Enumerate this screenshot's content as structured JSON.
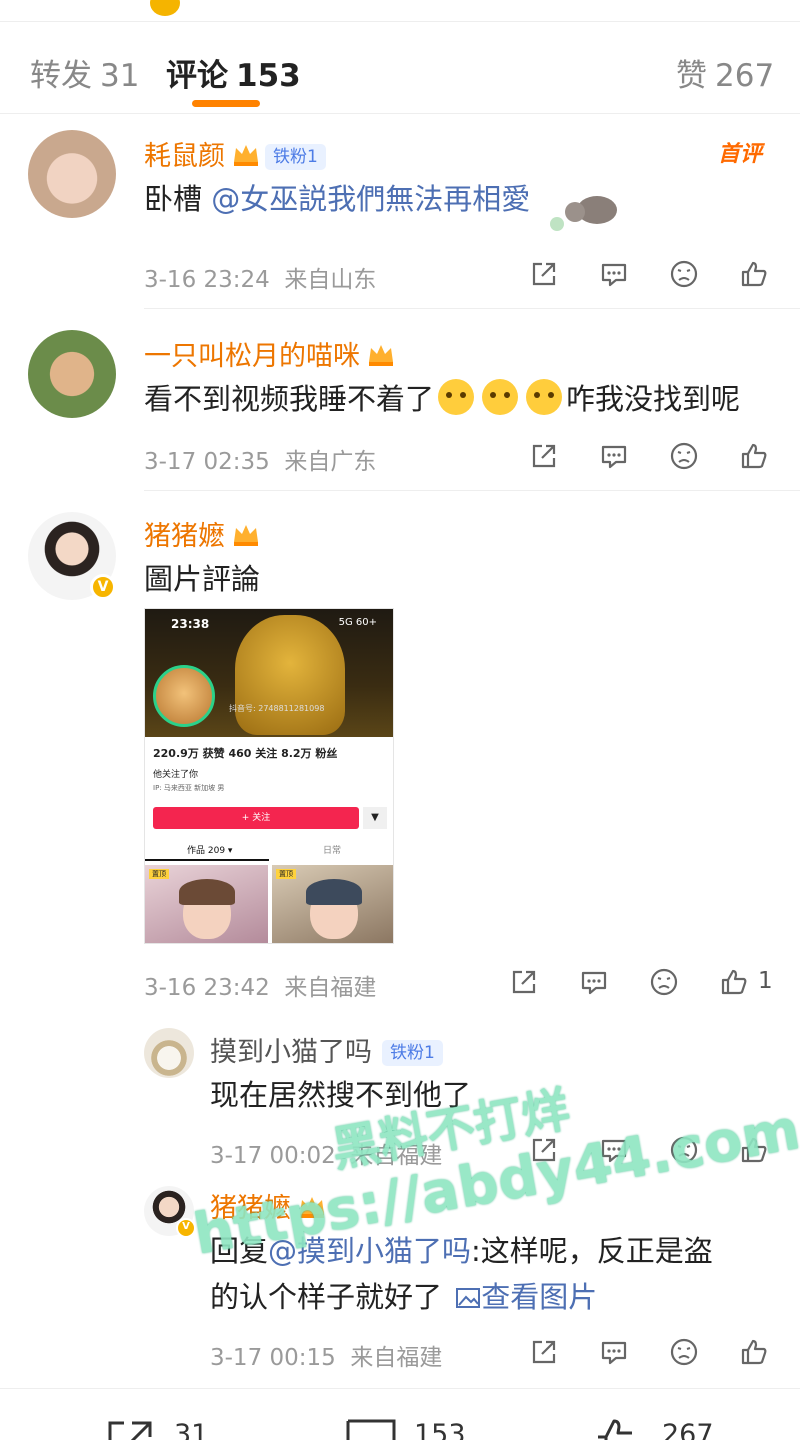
{
  "tabs": {
    "repost": {
      "label": "转发",
      "count": "31"
    },
    "comments": {
      "label": "评论",
      "count": "153"
    },
    "likes": {
      "label": "赞",
      "count": "267"
    }
  },
  "comments": [
    {
      "name": "耗鼠颜",
      "fan_badge": "铁粉1",
      "first_badge": "首评",
      "text_prefix": "卧槽 ",
      "mention": "@女巫説我們無法再相愛",
      "time": "3-16 23:24",
      "location": "来自山东"
    },
    {
      "name": "一只叫松月的喵咪",
      "text_part1": "看不到视频我睡不着了",
      "text_part2": "咋我没找到呢",
      "time": "3-17 02:35",
      "location": "来自广东"
    },
    {
      "name": "猪猪嬷",
      "text": "圖片評論",
      "time": "3-16 23:42",
      "location": "来自福建",
      "like_count": "1",
      "image": {
        "time": "23:38",
        "status": "5G 60+",
        "account_id": "抖音号: 2748811281098",
        "stats": "220.9万 获赞  460 关注  8.2万 粉丝",
        "follow_note": "他关注了你",
        "ip": "IP: 马来西亚  新加坡  男",
        "follow_button": "+ 关注",
        "tab_works": "作品 209 ▾",
        "tab_daily": "日常",
        "pin_tag": "置顶"
      }
    }
  ],
  "replies": [
    {
      "name": "摸到小猫了吗",
      "fan_badge": "铁粉1",
      "text": "现在居然搜不到他了",
      "time": "3-17 00:02",
      "location": "来自福建"
    },
    {
      "name": "猪猪嬷",
      "reply_prefix": "回复",
      "mention": "@摸到小猫了吗",
      "text_line1_rest": ":这样呢，反正是盗",
      "text_line2": "的认个样子就好了",
      "view_image": "查看图片",
      "time": "3-17 00:15",
      "location": "来自福建"
    }
  ],
  "bottom_bar": {
    "repost_count": "31",
    "comment_count": "153",
    "like_count": "267"
  },
  "watermark": {
    "line1": "黑料不打烊",
    "line2": "https://abdy44.com"
  },
  "colors": {
    "accent": "#ff8200",
    "name": "#ed7600",
    "mention": "#4d6fb3",
    "meta": "#9a9a9a"
  }
}
